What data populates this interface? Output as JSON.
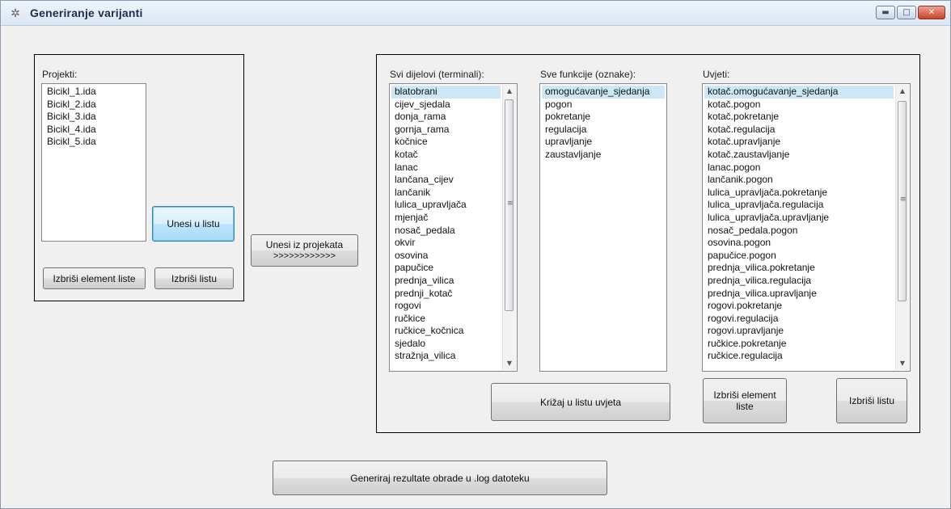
{
  "window": {
    "title": "Generiranje varijanti",
    "controls": {
      "minimize": "▬",
      "maximize": "□",
      "close": "✕"
    }
  },
  "projects_panel": {
    "label": "Projekti:",
    "items": [
      "Bicikl_1.ida",
      "Bicikl_2.ida",
      "Bicikl_3.ida",
      "Bicikl_4.ida",
      "Bicikl_5.ida"
    ],
    "add_button": "Unesi u listu",
    "delete_item_button": "Izbriši element liste",
    "delete_list_button": "Izbriši listu"
  },
  "import_button": {
    "line1": "Unesi iz projekata",
    "line2": ">>>>>>>>>>>>"
  },
  "parts_panel": {
    "label": "Svi dijelovi (terminali):",
    "items": [
      "blatobrani",
      "cijev_sjedala",
      "donja_rama",
      "gornja_rama",
      "kočnice",
      "kotač",
      "lanac",
      "lančana_cijev",
      "lančanik",
      "lulica_upravljača",
      "mjenjač",
      "nosač_pedala",
      "okvir",
      "osovina",
      "papučice",
      "prednja_vilica",
      "prednji_kotač",
      "rogovi",
      "ručkice",
      "ručkice_kočnica",
      "sjedalo",
      "stražnja_vilica"
    ],
    "selected_index": 0
  },
  "functions_panel": {
    "label": "Sve  funkcije (oznake):",
    "items": [
      "omogućavanje_sjedanja",
      "pogon",
      "pokretanje",
      "regulacija",
      "upravljanje",
      "zaustavljanje"
    ],
    "selected_index": 0
  },
  "conditions_panel": {
    "label": "Uvjeti:",
    "items": [
      "kotač.omogućavanje_sjedanja",
      "kotač.pogon",
      "kotač.pokretanje",
      "kotač.regulacija",
      "kotač.upravljanje",
      "kotač.zaustavljanje",
      "lanac.pogon",
      "lančanik.pogon",
      "lulica_upravljača.pokretanje",
      "lulica_upravljača.regulacija",
      "lulica_upravljača.upravljanje",
      "nosač_pedala.pogon",
      "osovina.pogon",
      "papučice.pogon",
      "prednja_vilica.pokretanje",
      "prednja_vilica.regulacija",
      "prednja_vilica.upravljanje",
      "rogovi.pokretanje",
      "rogovi.regulacija",
      "rogovi.upravljanje",
      "ručkice.pokretanje",
      "ručkice.regulacija"
    ],
    "selected_index": 0
  },
  "cross_button": "Križaj u listu uvjeta",
  "cond_delete_item_button": {
    "line1": "Izbriši element",
    "line2": "liste"
  },
  "cond_delete_list_button": "Izbriši listu",
  "generate_button": "Generiraj rezultate obrade u .log datoteku",
  "icons": {
    "app": "gear-icon",
    "scroll_up": "▲",
    "scroll_down": "▼",
    "grip": "≡"
  },
  "colors": {
    "selection": "#cce8f7",
    "window_bg": "#f0f0f0"
  }
}
